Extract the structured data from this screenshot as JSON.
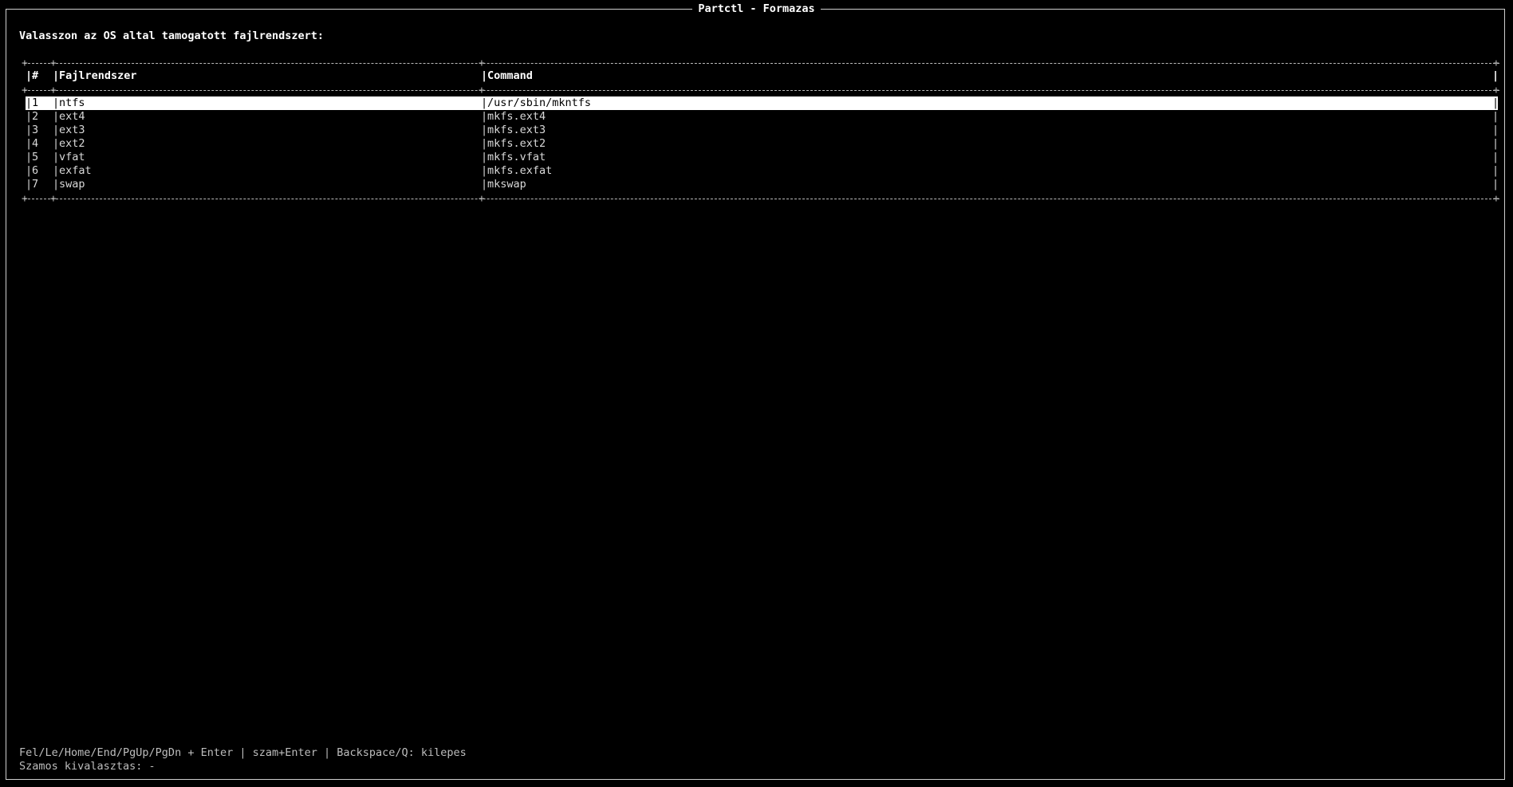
{
  "window": {
    "title": "Partctl - Formazas"
  },
  "prompt": "Valasszon az OS altal tamogatott fajlrendszert:",
  "table": {
    "columns": [
      "#",
      "Fajlrendszer",
      "Command"
    ],
    "rows": [
      {
        "num": "1",
        "fs": "ntfs",
        "cmd": "/usr/sbin/mkntfs",
        "selected": true
      },
      {
        "num": "2",
        "fs": "ext4",
        "cmd": "mkfs.ext4"
      },
      {
        "num": "3",
        "fs": "ext3",
        "cmd": "mkfs.ext3"
      },
      {
        "num": "4",
        "fs": "ext2",
        "cmd": "mkfs.ext2"
      },
      {
        "num": "5",
        "fs": "vfat",
        "cmd": "mkfs.vfat"
      },
      {
        "num": "6",
        "fs": "exfat",
        "cmd": "mkfs.exfat"
      },
      {
        "num": "7",
        "fs": "swap",
        "cmd": "mkswap"
      }
    ]
  },
  "footer": {
    "help": "Fel/Le/Home/End/PgUp/PgDn + Enter | szam+Enter | Backspace/Q: kilepes",
    "selection": "Szamos kivalasztas: -"
  },
  "colors": {
    "background": "#000000",
    "foreground": "#d9d9d9",
    "selected_bg": "#ffffff",
    "selected_fg": "#000000"
  }
}
